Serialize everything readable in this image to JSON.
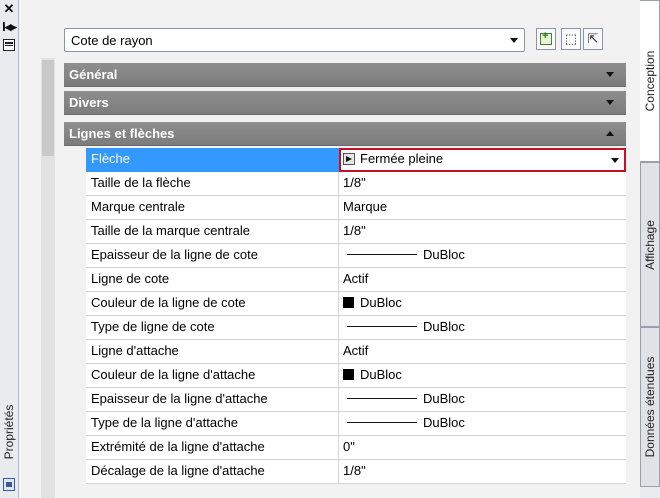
{
  "palette": {
    "title": "Propriétés"
  },
  "toolbar": {
    "selected_object": "Cote de rayon"
  },
  "categories": {
    "general": "Général",
    "divers": "Divers",
    "lignes": "Lignes et flèches"
  },
  "properties": [
    {
      "name": "Flèche",
      "value": "Fermée pleine",
      "kind": "dropdown"
    },
    {
      "name": "Taille de la flèche",
      "value": "1/8\"",
      "kind": "text"
    },
    {
      "name": "Marque centrale",
      "value": "Marque",
      "kind": "text"
    },
    {
      "name": "Taille de la marque centrale",
      "value": "1/8\"",
      "kind": "text"
    },
    {
      "name": "Epaisseur de la ligne de cote",
      "value": "DuBloc",
      "kind": "lineweight"
    },
    {
      "name": "Ligne de cote",
      "value": "Actif",
      "kind": "text"
    },
    {
      "name": "Couleur de la ligne de cote",
      "value": "DuBloc",
      "kind": "color"
    },
    {
      "name": "Type de ligne de cote",
      "value": "DuBloc",
      "kind": "linetype"
    },
    {
      "name": "Ligne d'attache",
      "value": "Actif",
      "kind": "text"
    },
    {
      "name": "Couleur de la ligne d'attache",
      "value": "DuBloc",
      "kind": "color"
    },
    {
      "name": "Epaisseur de la ligne d'attache",
      "value": "DuBloc",
      "kind": "lineweight"
    },
    {
      "name": "Type de la ligne d'attache",
      "value": "DuBloc",
      "kind": "linetype"
    },
    {
      "name": "Extrémité de la ligne d'attache",
      "value": "0\"",
      "kind": "text"
    },
    {
      "name": "Décalage de la ligne d'attache",
      "value": "1/8\"",
      "kind": "text"
    }
  ],
  "tabs": [
    "Conception",
    "Affichage",
    "Données étendues"
  ],
  "colors": {
    "selection": "#3399ff",
    "focus_border": "#c5102a",
    "category_header": "#808080"
  }
}
